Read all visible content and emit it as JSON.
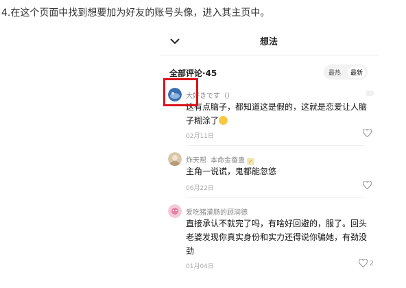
{
  "instruction": "4.在这个页面中找到想要加为好友的账号头像，进入其主页中。",
  "topbar": {
    "title": "想法",
    "back_icon": "chevron-down-icon"
  },
  "comments_header": {
    "label": "全部评论·45"
  },
  "sort_toggle": {
    "hot": "最热",
    "new": "最新",
    "active": "new"
  },
  "highlight_color": "#d9141c",
  "comments": [
    {
      "username": "大好きです（）",
      "text_line1": "这有点脑子，都知道这是假的，这就是恋爱让人脑",
      "text_line2": "子糊涂了",
      "date": "02月11日",
      "likes": "",
      "avatar_color": "#3b6fb0"
    },
    {
      "username": "炸天帮",
      "badge": "本命金蚕蛊",
      "text_line1": "主角一说谎，鬼都能忽悠",
      "date": "06月22日",
      "likes": "",
      "avatar_color": "#d8c7a8"
    },
    {
      "username": "爱吃猪灌肠的顾润德",
      "text_line1": "直接承认不就完了吗，有啥好回避的，服了。回头",
      "text_line2": "老婆发现你真实身份和实力还得说你骗她，有劲没",
      "text_line3": "劲",
      "date": "01月04日",
      "likes": "2",
      "avatar_color": "#f4c9d8"
    }
  ]
}
